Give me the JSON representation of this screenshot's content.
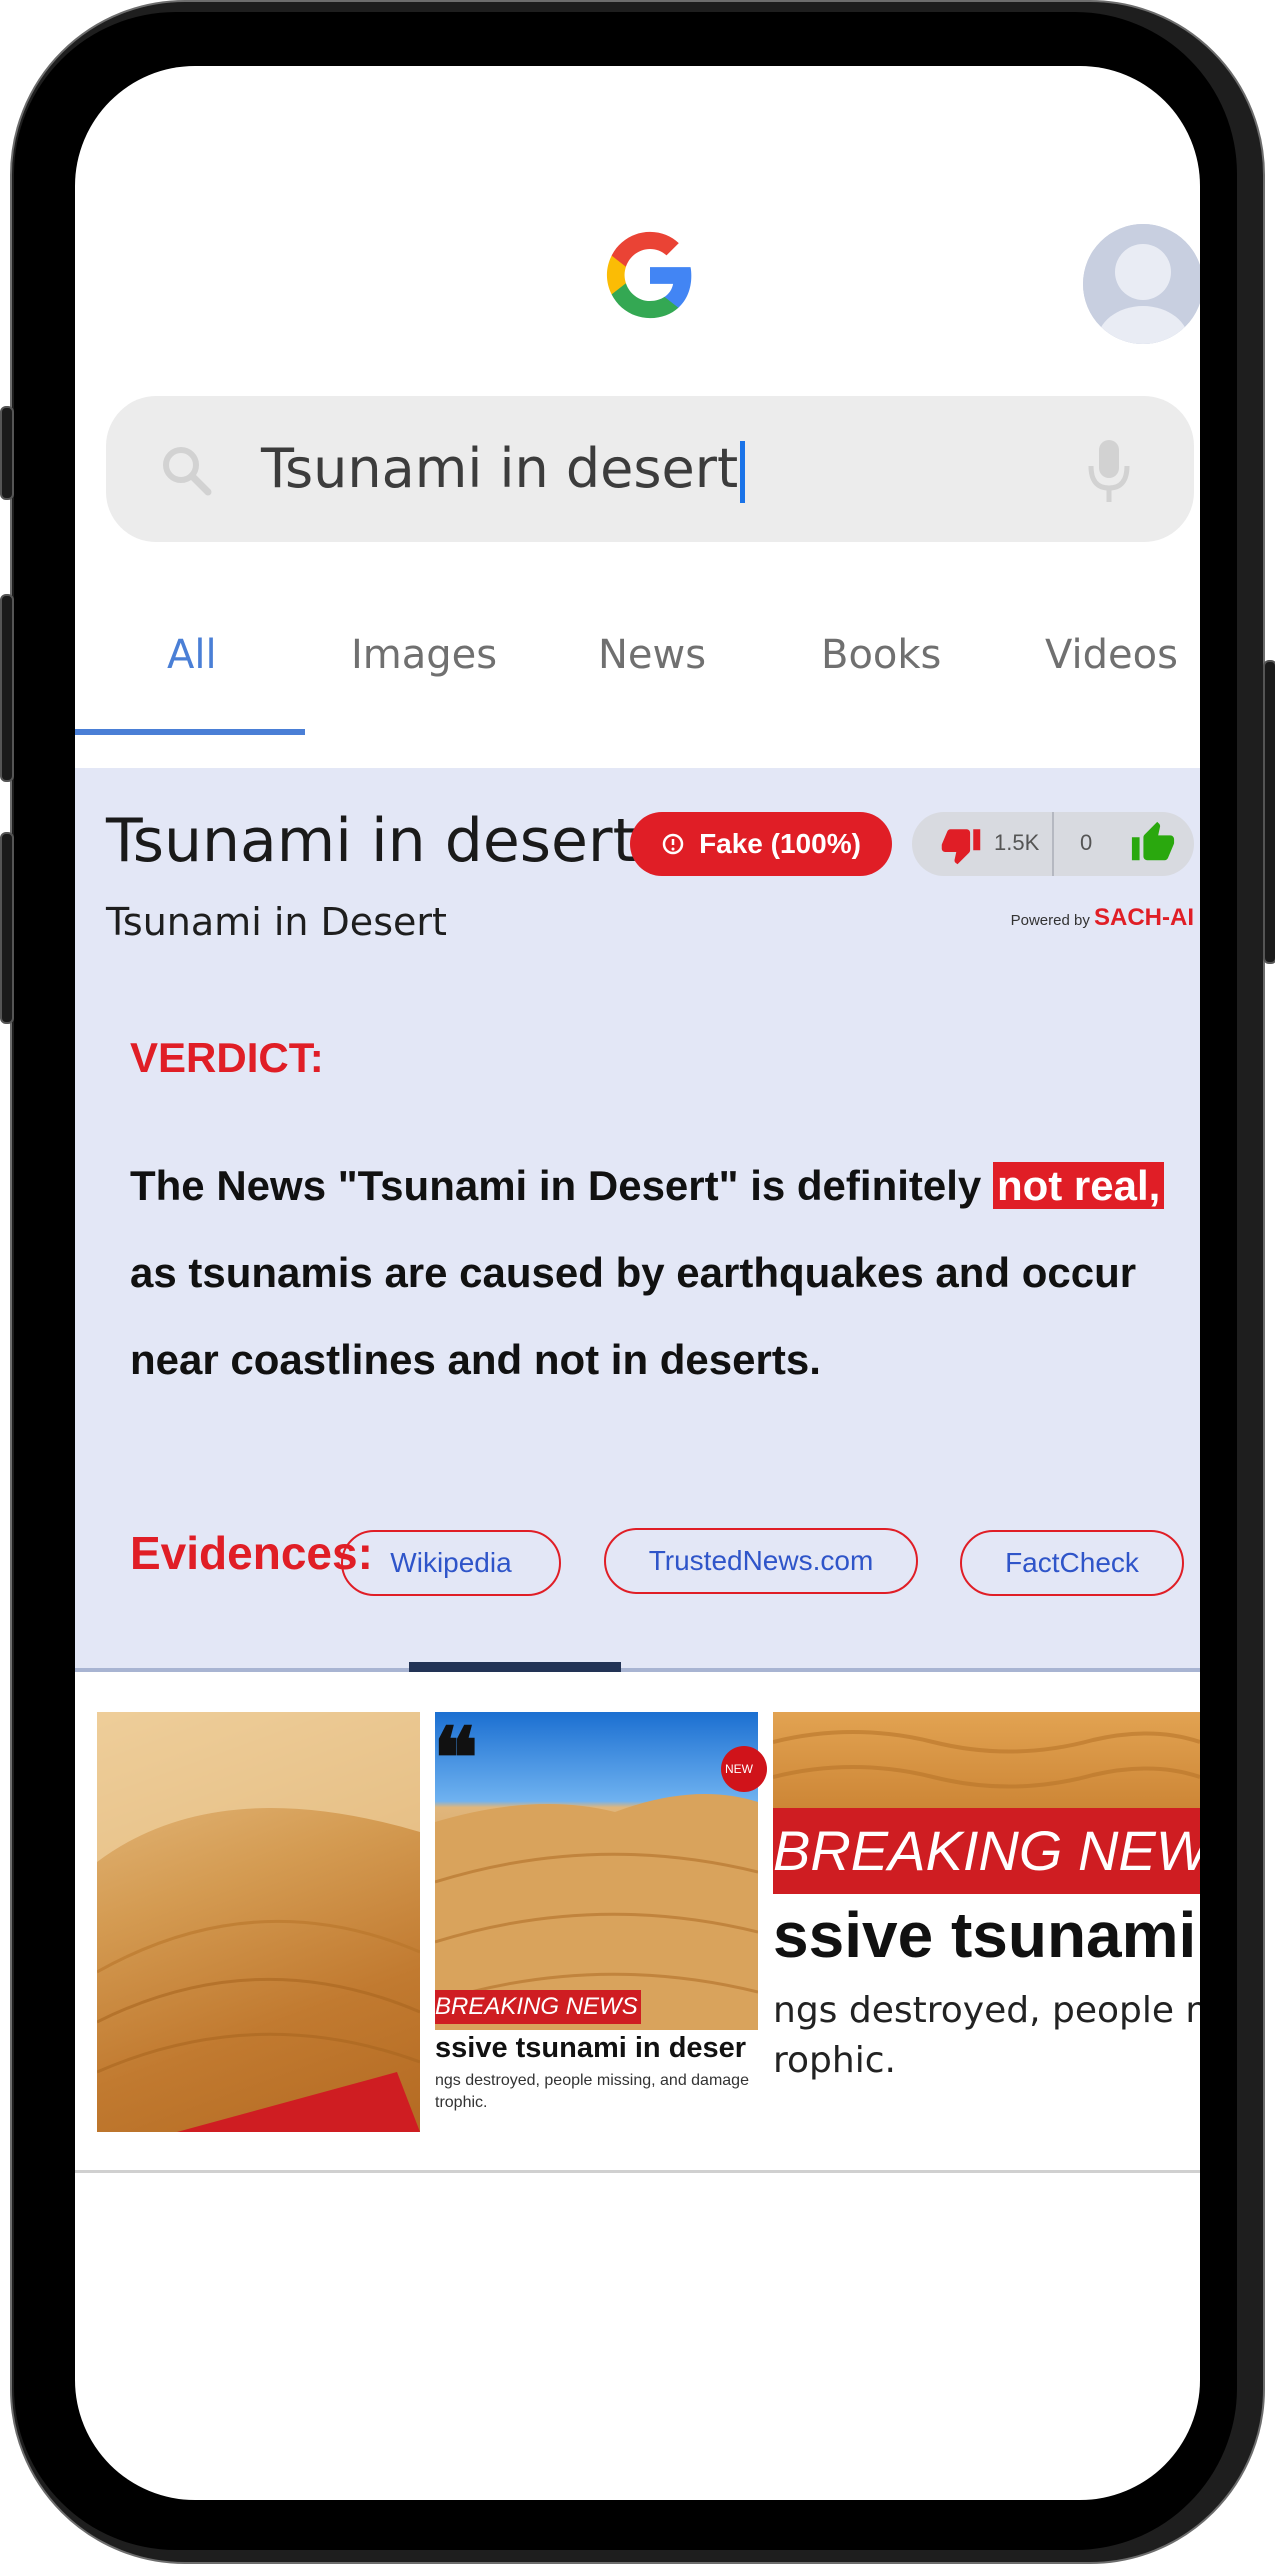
{
  "search": {
    "query": "Tsunami in desert"
  },
  "tabs": [
    {
      "label": "All"
    },
    {
      "label": "Images"
    },
    {
      "label": "News"
    },
    {
      "label": "Books"
    },
    {
      "label": "Videos"
    }
  ],
  "result": {
    "title": "Tsunami in desert",
    "subtitle": "Tsunami in Desert",
    "badge": "Fake (100%)",
    "dislike_count": "1.5K",
    "like_count": "0",
    "powered_by_prefix": "Powered by",
    "powered_by_brand": "SACH-AI",
    "verdict_label": "VERDICT:",
    "verdict_text_before": "The News \"Tsunami in Desert\" is definitely",
    "verdict_highlight": "not real,",
    "verdict_text_after": "as tsunamis are caused by earthquakes and occur near coastlines and not in deserts.",
    "evidence_label": "Evidences:",
    "evidences": [
      {
        "label": "Wikipedia"
      },
      {
        "label": "TrustedNews.com"
      },
      {
        "label": "FactCheck"
      }
    ]
  },
  "images": {
    "thumb2_breaking": "BREAKING NEWS",
    "thumb2_headline": "ssive tsunami in deser",
    "thumb2_sub_line1": "ngs destroyed, people missing, and damage",
    "thumb2_sub_line2": "trophic.",
    "thumb2_corner": "NEW",
    "thumb3_breaking": "BREAKING NEWS",
    "thumb3_headline": "ssive tsunami",
    "thumb3_sub_line1": "ngs destroyed, people miss",
    "thumb3_sub_line2": "rophic."
  },
  "colors": {
    "accent_red": "#e01e26",
    "tab_blue": "#4a7fd6",
    "card_bg": "#e3e7f6"
  }
}
